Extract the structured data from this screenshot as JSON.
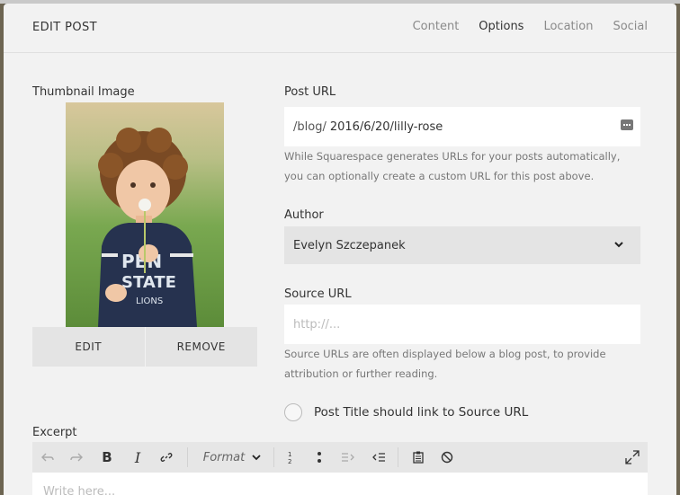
{
  "header": {
    "title": "EDIT POST",
    "tabs": [
      "Content",
      "Options",
      "Location",
      "Social"
    ],
    "active_tab": "Options"
  },
  "thumbnail": {
    "label": "Thumbnail Image",
    "edit_label": "EDIT",
    "remove_label": "REMOVE"
  },
  "post_url": {
    "label": "Post URL",
    "prefix": "/blog/",
    "value": "2016/6/20/lilly-rose",
    "help_line1": "While Squarespace generates URLs for your posts automatically,",
    "help_line2": "you can optionally create a custom URL for this post above."
  },
  "author": {
    "label": "Author",
    "selected": "Evelyn Szczepanek"
  },
  "source_url": {
    "label": "Source URL",
    "placeholder": "http://...",
    "help_line1": "Source URLs are often displayed below a blog post, to provide",
    "help_line2": "attribution or further reading."
  },
  "link_option": {
    "label": "Post Title should link to Source URL"
  },
  "excerpt": {
    "label": "Excerpt",
    "format_label": "Format",
    "placeholder": "Write here..."
  },
  "colors": {
    "panel_bg": "#f2f2f2",
    "field_bg": "#ffffff",
    "select_bg": "#e4e4e4"
  },
  "icons": [
    "undo-icon",
    "redo-icon",
    "bold-icon",
    "italic-icon",
    "link-icon",
    "ordered-list-icon",
    "bullet-list-icon",
    "indent-icon",
    "outdent-icon",
    "paste-icon",
    "clear-format-icon",
    "expand-icon",
    "chevron-down-icon",
    "dots-icon"
  ]
}
